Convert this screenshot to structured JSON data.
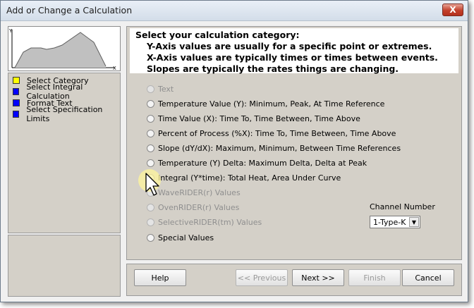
{
  "window": {
    "title": "Add or Change a Calculation",
    "close_label": "X"
  },
  "thumbnail": {
    "y_label": "Y",
    "x_label": "X"
  },
  "steps": [
    {
      "label": "Select Category",
      "color": "#ffff00"
    },
    {
      "label": "Select Integral Calculation",
      "color": "#0000ff"
    },
    {
      "label": "Format Text",
      "color": "#0000ff"
    },
    {
      "label": "Select Specification Limits",
      "color": "#0000ff"
    }
  ],
  "header": {
    "title": "Select your calculation category:",
    "lines": [
      "Y-Axis values are usually for a specific point or extremes.",
      "X-Axis values are typically times or times between events.",
      "Slopes are typically the rates things are changing."
    ]
  },
  "options": [
    {
      "label": "Text",
      "enabled": false
    },
    {
      "label": "Temperature Value (Y):  Minimum, Peak, At Time Reference",
      "enabled": true
    },
    {
      "label": "Time Value (X):  Time To, Time Between, Time Above",
      "enabled": true
    },
    {
      "label": "Percent of Process (%X):  Time To, Time Between, Time Above",
      "enabled": true
    },
    {
      "label": "Slope (dY/dX):  Maximum, Minimum, Between Time References",
      "enabled": true
    },
    {
      "label": "Temperature (Y) Delta:  Maximum Delta, Delta at Peak",
      "enabled": true
    },
    {
      "label": "Integral (Y*time): Total Heat, Area Under Curve",
      "enabled": true
    },
    {
      "label": "WaveRIDER(r) Values",
      "enabled": false
    },
    {
      "label": "OvenRIDER(r) Values",
      "enabled": false
    },
    {
      "label": "SelectiveRIDER(tm) Values",
      "enabled": false
    },
    {
      "label": "Special  Values",
      "enabled": true
    }
  ],
  "channel": {
    "label": "Channel Number",
    "value": "1-Type-K"
  },
  "buttons": {
    "help": "Help",
    "previous": "<< Previous",
    "next": "Next >>",
    "finish": "Finish",
    "cancel": "Cancel"
  }
}
